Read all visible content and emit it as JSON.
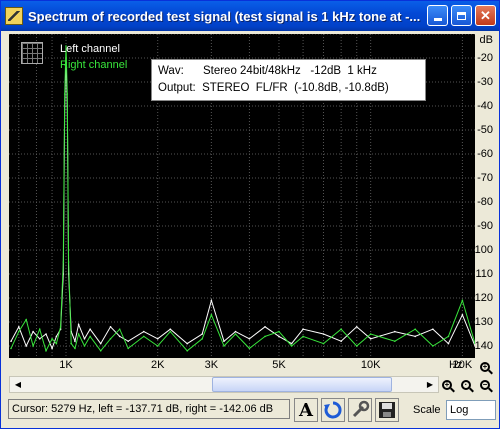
{
  "window": {
    "title": "Spectrum of recorded test signal (test signal is 1 kHz tone at -...",
    "minimize_icon": "minimize-icon",
    "maximize_icon": "maximize-icon",
    "close_icon": "close-icon"
  },
  "legend": {
    "left": "Left channel",
    "right": "Right channel"
  },
  "info": {
    "wav_label": "Wav:",
    "wav_value": "Stereo 24bit/48kHz   -12dB  1 kHz",
    "output_label": "Output:",
    "output_value": "STEREO  FL/FR  (-10.8dB, -10.8dB)"
  },
  "statusbar": {
    "cursor_text": "Cursor:  5279 Hz,  left = -137.71 dB,  right = -142.06 dB",
    "scale_label": "Scale",
    "scale_value": "Log"
  },
  "colors": {
    "left_channel": "#ffffff",
    "right_channel": "#39e63c",
    "background": "#000000"
  },
  "chart_data": {
    "type": "line",
    "title": "",
    "xlabel": "Hz",
    "ylabel": "dB",
    "x_scale": "log",
    "xlim": [
      650,
      22000
    ],
    "ylim": [
      -145,
      -10
    ],
    "grid": true,
    "x_ticks": [
      {
        "label": "1K",
        "value": 1000
      },
      {
        "label": "2K",
        "value": 2000
      },
      {
        "label": "3K",
        "value": 3000
      },
      {
        "label": "5K",
        "value": 5000
      },
      {
        "label": "10K",
        "value": 10000
      },
      {
        "label": "20K",
        "value": 20000
      }
    ],
    "x_gridlines": [
      700,
      800,
      900,
      1000,
      2000,
      3000,
      4000,
      5000,
      6000,
      7000,
      8000,
      9000,
      10000,
      20000
    ],
    "y_ticks": [
      {
        "label": "dB",
        "value": -10
      },
      {
        "label": "-20",
        "value": -20
      },
      {
        "label": "-30",
        "value": -30
      },
      {
        "label": "-40",
        "value": -40
      },
      {
        "label": "-50",
        "value": -50
      },
      {
        "label": "-60",
        "value": -60
      },
      {
        "label": "-70",
        "value": -70
      },
      {
        "label": "-80",
        "value": -80
      },
      {
        "label": "-90",
        "value": -90
      },
      {
        "label": "-100",
        "value": -100
      },
      {
        "label": "-110",
        "value": -110
      },
      {
        "label": "-120",
        "value": -120
      },
      {
        "label": "-130",
        "value": -130
      },
      {
        "label": "-140",
        "value": -140
      }
    ],
    "series": [
      {
        "name": "Left channel",
        "color": "#ffffff",
        "x": [
          660,
          700,
          740,
          780,
          820,
          860,
          900,
          930,
          960,
          980,
          990,
          1000,
          1010,
          1020,
          1040,
          1070,
          1100,
          1150,
          1200,
          1300,
          1400,
          1500,
          1600,
          1800,
          2000,
          2200,
          2500,
          2800,
          3000,
          3300,
          3600,
          4000,
          4500,
          5000,
          5500,
          6000,
          7000,
          8000,
          9000,
          10000,
          12000,
          14000,
          16000,
          18000,
          20000,
          22000
        ],
        "y": [
          -138,
          -132,
          -140,
          -134,
          -137,
          -135,
          -141,
          -136,
          -133,
          -110,
          -40,
          -20,
          -40,
          -110,
          -134,
          -138,
          -131,
          -137,
          -133,
          -139,
          -132,
          -136,
          -138,
          -134,
          -137,
          -133,
          -139,
          -135,
          -121,
          -138,
          -134,
          -137,
          -132,
          -136,
          -139,
          -133,
          -135,
          -138,
          -132,
          -137,
          -134,
          -136,
          -133,
          -139,
          -127,
          -140
        ]
      },
      {
        "name": "Right channel",
        "color": "#39e63c",
        "x": [
          660,
          700,
          740,
          780,
          820,
          860,
          900,
          930,
          960,
          980,
          990,
          1000,
          1010,
          1020,
          1040,
          1070,
          1100,
          1150,
          1200,
          1300,
          1400,
          1500,
          1600,
          1800,
          2000,
          2200,
          2500,
          2800,
          3000,
          3300,
          3600,
          4000,
          4500,
          5000,
          5500,
          6000,
          7000,
          8000,
          9000,
          10000,
          12000,
          14000,
          16000,
          18000,
          20000,
          22000
        ],
        "y": [
          -141,
          -134,
          -129,
          -140,
          -133,
          -142,
          -137,
          -139,
          -132,
          -105,
          -35,
          -15,
          -35,
          -105,
          -139,
          -141,
          -135,
          -140,
          -136,
          -142,
          -137,
          -133,
          -141,
          -136,
          -140,
          -134,
          -142,
          -137,
          -127,
          -140,
          -135,
          -141,
          -136,
          -134,
          -140,
          -136,
          -139,
          -133,
          -140,
          -135,
          -138,
          -133,
          -140,
          -136,
          -121,
          -139
        ]
      }
    ]
  }
}
